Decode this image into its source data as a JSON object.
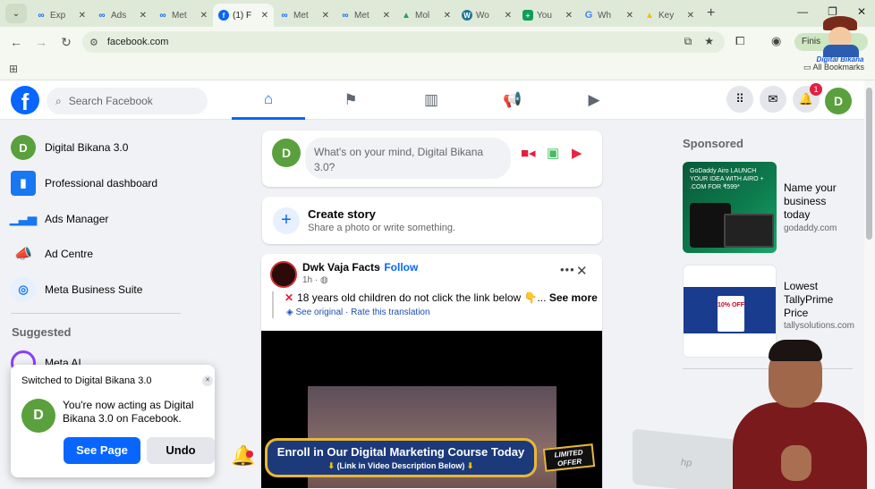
{
  "browser": {
    "tabs": [
      {
        "label": "Exp",
        "icon": "meta-icon",
        "color": "#0866ff"
      },
      {
        "label": "Ads",
        "icon": "meta-icon",
        "color": "#0866ff"
      },
      {
        "label": "Met",
        "icon": "meta-icon",
        "color": "#0866ff"
      },
      {
        "label": "(1) F",
        "icon": "facebook-icon",
        "color": "#0866ff",
        "active": true
      },
      {
        "label": "Met",
        "icon": "meta-icon",
        "color": "#0866ff"
      },
      {
        "label": "Met",
        "icon": "meta-icon",
        "color": "#0866ff"
      },
      {
        "label": "Mol",
        "icon": "google-drive-icon",
        "color": "#1fa463"
      },
      {
        "label": "Wo",
        "icon": "wordpress-icon",
        "color": "#21759b"
      },
      {
        "label": "You",
        "icon": "google-sheets-icon",
        "color": "#0f9d58"
      },
      {
        "label": "Wh",
        "icon": "google-icon",
        "color": "#4285f4"
      },
      {
        "label": "Key",
        "icon": "google-ads-icon",
        "color": "#fbbc04"
      }
    ],
    "url": "facebook.com",
    "finish_label": "Finis",
    "all_bookmarks": "All Bookmarks"
  },
  "brand_badge": {
    "name": "Digital Bikana"
  },
  "fb": {
    "logo": "f",
    "search_placeholder": "Search Facebook",
    "notif_count": "1",
    "me_initial": "D"
  },
  "sidebar": {
    "items": [
      {
        "label": "Digital Bikana 3.0",
        "icon": "D",
        "color": "#5aa03c"
      },
      {
        "label": "Professional dashboard",
        "icon": "▮",
        "color": "#1877f2"
      },
      {
        "label": "Ads Manager",
        "icon": "▮",
        "color": "#1877f2"
      },
      {
        "label": "Ad Centre",
        "icon": "◢",
        "color": "#1877f2"
      },
      {
        "label": "Meta Business Suite",
        "icon": "◎",
        "color": "#1877f2"
      },
      {
        "label": "Meta AI",
        "icon": "◯",
        "color": "#8a3ffc"
      }
    ],
    "suggested": "Suggested"
  },
  "toast": {
    "title": "Switched to Digital Bikana 3.0",
    "message": "You're now acting as Digital Bikana 3.0 on Facebook.",
    "avatar": "D",
    "see_page": "See Page",
    "undo": "Undo"
  },
  "composer": {
    "avatar": "D",
    "placeholder": "What's on your mind, Digital Bikana 3.0?"
  },
  "story": {
    "title": "Create story",
    "subtitle": "Share a photo or write something."
  },
  "post": {
    "author": "Dwk Vaja Facts",
    "follow": "Follow",
    "meta": "1h · ◍",
    "text": "18 years old children do not click the link below 👇...",
    "see_more": "See more",
    "translation": "See original · Rate this translation"
  },
  "sponsored": {
    "heading": "Sponsored",
    "ads": [
      {
        "title": "Name your business today",
        "domain": "godaddy.com",
        "image_text": "GoDaddy Airo  LAUNCH YOUR IDEA WITH AIRO + .COM FOR ₹599*"
      },
      {
        "title": "Lowest TallyPrime Price",
        "domain": "tallysolutions.com",
        "image_text": "10% OFF"
      }
    ]
  },
  "overlay": {
    "banner_main": "Enroll in Our Digital Marketing Course Today",
    "banner_sub": "(Link in Video Description Below)",
    "limited": "LIMITED OFFER",
    "laptop_logo": "hp"
  }
}
